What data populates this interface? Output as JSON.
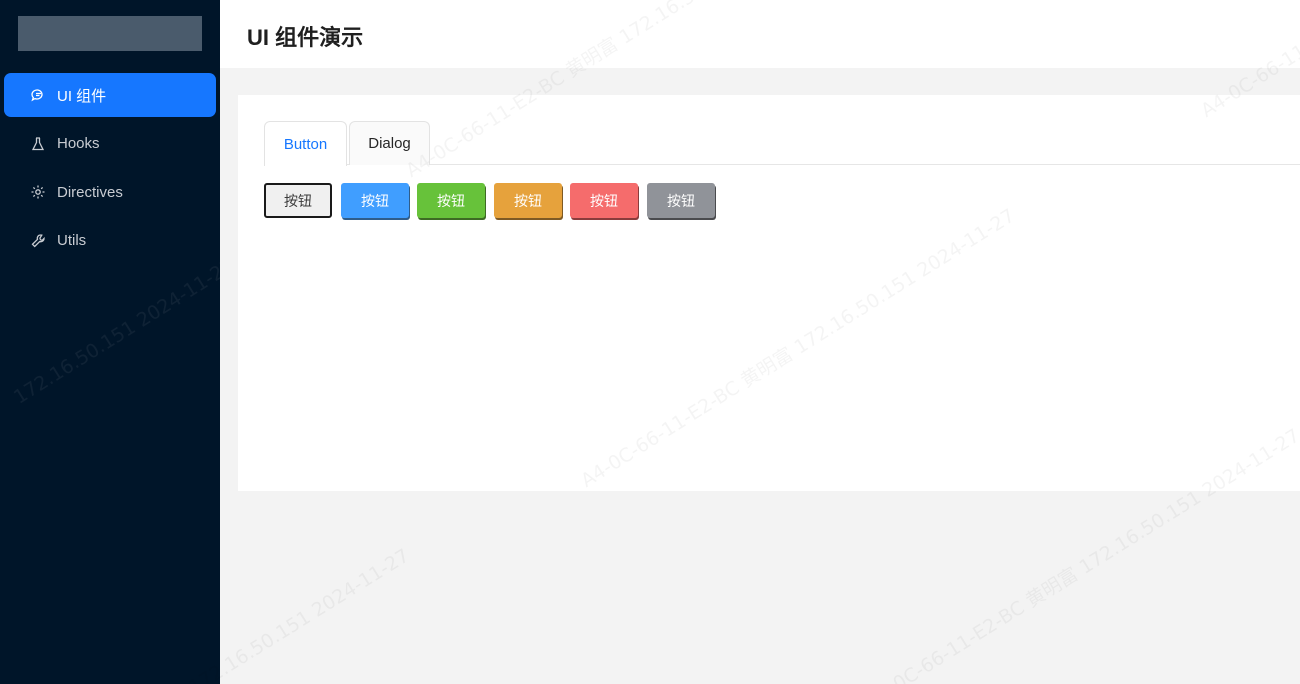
{
  "sidebar": {
    "items": [
      {
        "label": "UI 组件",
        "icon": "chat-bubbles-icon",
        "active": true
      },
      {
        "label": "Hooks",
        "icon": "flask-icon",
        "active": false
      },
      {
        "label": "Directives",
        "icon": "gear-icon",
        "active": false
      },
      {
        "label": "Utils",
        "icon": "wrench-icon",
        "active": false
      }
    ]
  },
  "header": {
    "title": "UI 组件演示"
  },
  "tabs": [
    {
      "label": "Button",
      "active": true
    },
    {
      "label": "Dialog",
      "active": false
    }
  ],
  "buttons": [
    {
      "label": "按钮",
      "type": "default",
      "color": "#f0f0f0"
    },
    {
      "label": "按钮",
      "type": "primary",
      "color": "#409eff"
    },
    {
      "label": "按钮",
      "type": "success",
      "color": "#67c23a"
    },
    {
      "label": "按钮",
      "type": "warning",
      "color": "#e6a23c"
    },
    {
      "label": "按钮",
      "type": "danger",
      "color": "#f56c6c"
    },
    {
      "label": "按钮",
      "type": "info",
      "color": "#909399"
    }
  ],
  "colors": {
    "sidebar_bg": "#001529",
    "accent": "#1677ff"
  },
  "watermark": {
    "line_a": "172.16.50.151  2024-11-27",
    "line_b": "A4-0C-66-11-E2-BC  黄明富  172.16.50.151  2024-11-27"
  }
}
